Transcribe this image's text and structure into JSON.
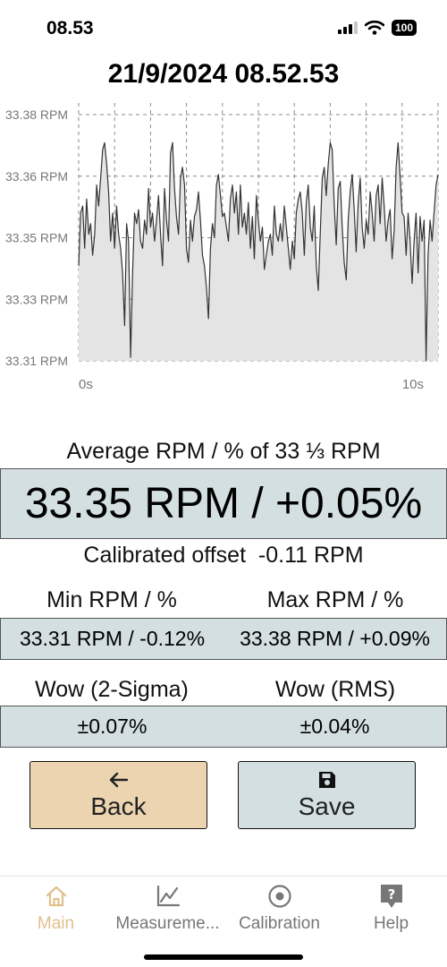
{
  "status_bar": {
    "time": "08.53",
    "battery": "100"
  },
  "header": {
    "timestamp": "21/9/2024 08.52.53"
  },
  "chart_data": {
    "type": "area",
    "y_tick_labels": [
      "33.38 RPM",
      "33.36 RPM",
      "33.35 RPM",
      "33.33 RPM",
      "33.31 RPM"
    ],
    "y_ticks": [
      33.38,
      33.36,
      33.35,
      33.33,
      33.31
    ],
    "x_tick_labels": [
      "0s",
      "10s"
    ],
    "xlim": [
      0,
      10
    ],
    "ylim": [
      33.31,
      33.38
    ],
    "grid": true,
    "values": [
      33.337,
      33.352,
      33.354,
      33.342,
      33.356,
      33.346,
      33.349,
      33.34,
      33.346,
      33.36,
      33.354,
      33.362,
      33.37,
      33.372,
      33.366,
      33.358,
      33.344,
      33.352,
      33.342,
      33.354,
      33.346,
      33.342,
      33.335,
      33.32,
      33.349,
      33.344,
      33.311,
      33.335,
      33.352,
      33.349,
      33.353,
      33.344,
      33.342,
      33.35,
      33.346,
      33.359,
      33.348,
      33.352,
      33.344,
      33.35,
      33.357,
      33.346,
      33.337,
      33.359,
      33.35,
      33.344,
      33.369,
      33.372,
      33.359,
      33.351,
      33.346,
      33.362,
      33.365,
      33.36,
      33.342,
      33.338,
      33.35,
      33.344,
      33.351,
      33.353,
      33.358,
      33.35,
      33.34,
      33.337,
      33.331,
      33.322,
      33.342,
      33.349,
      33.345,
      33.36,
      33.363,
      33.357,
      33.351,
      33.352,
      33.348,
      33.344,
      33.356,
      33.36,
      33.352,
      33.358,
      33.346,
      33.36,
      33.348,
      33.352,
      33.346,
      33.355,
      33.342,
      33.351,
      33.339,
      33.357,
      33.35,
      33.344,
      33.348,
      33.336,
      33.34,
      33.344,
      33.346,
      33.34,
      33.354,
      33.346,
      33.344,
      33.349,
      33.344,
      33.354,
      33.348,
      33.342,
      33.336,
      33.344,
      33.339,
      33.352,
      33.356,
      33.358,
      33.352,
      33.34,
      33.355,
      33.36,
      33.348,
      33.344,
      33.354,
      33.337,
      33.33,
      33.346,
      33.362,
      33.365,
      33.357,
      33.366,
      33.372,
      33.37,
      33.354,
      33.343,
      33.359,
      33.361,
      33.348,
      33.338,
      33.333,
      33.35,
      33.358,
      33.363,
      33.353,
      33.341,
      33.355,
      33.362,
      33.348,
      33.342,
      33.35,
      33.346,
      33.358,
      33.352,
      33.344,
      33.357,
      33.36,
      33.349,
      33.362,
      33.354,
      33.344,
      33.35,
      33.353,
      33.339,
      33.347,
      33.365,
      33.372,
      33.362,
      33.352,
      33.351,
      33.34,
      33.352,
      33.344,
      33.332,
      33.344,
      33.352,
      33.335,
      33.351,
      33.344,
      33.35,
      33.31,
      33.34,
      33.35,
      33.344,
      33.352,
      33.36,
      33.363
    ]
  },
  "summary": {
    "avg_label": "Average RPM / % of 33 ⅓ RPM",
    "avg_value": "33.35 RPM / +0.05%",
    "offset_label": "Calibrated offset",
    "offset_value": "-0.11 RPM",
    "min_label": "Min RPM / %",
    "max_label": "Max RPM / %",
    "min_value": "33.31 RPM / -0.12%",
    "max_value": "33.38 RPM / +0.09%",
    "wow2_label": "Wow (2-Sigma)",
    "wowrms_label": "Wow (RMS)",
    "wow2_value": "±0.07%",
    "wowrms_value": "±0.04%"
  },
  "buttons": {
    "back": "Back",
    "save": "Save"
  },
  "tabs": [
    {
      "label": "Main",
      "icon": "home-icon",
      "active": true
    },
    {
      "label": "Measureme...",
      "icon": "chart-icon",
      "active": false
    },
    {
      "label": "Calibration",
      "icon": "target-icon",
      "active": false
    },
    {
      "label": "Help",
      "icon": "help-icon",
      "active": false
    }
  ],
  "colors": {
    "accent": "#e0c08c",
    "panel": "#d3dfe0",
    "back_button": "#ecd4b1"
  }
}
